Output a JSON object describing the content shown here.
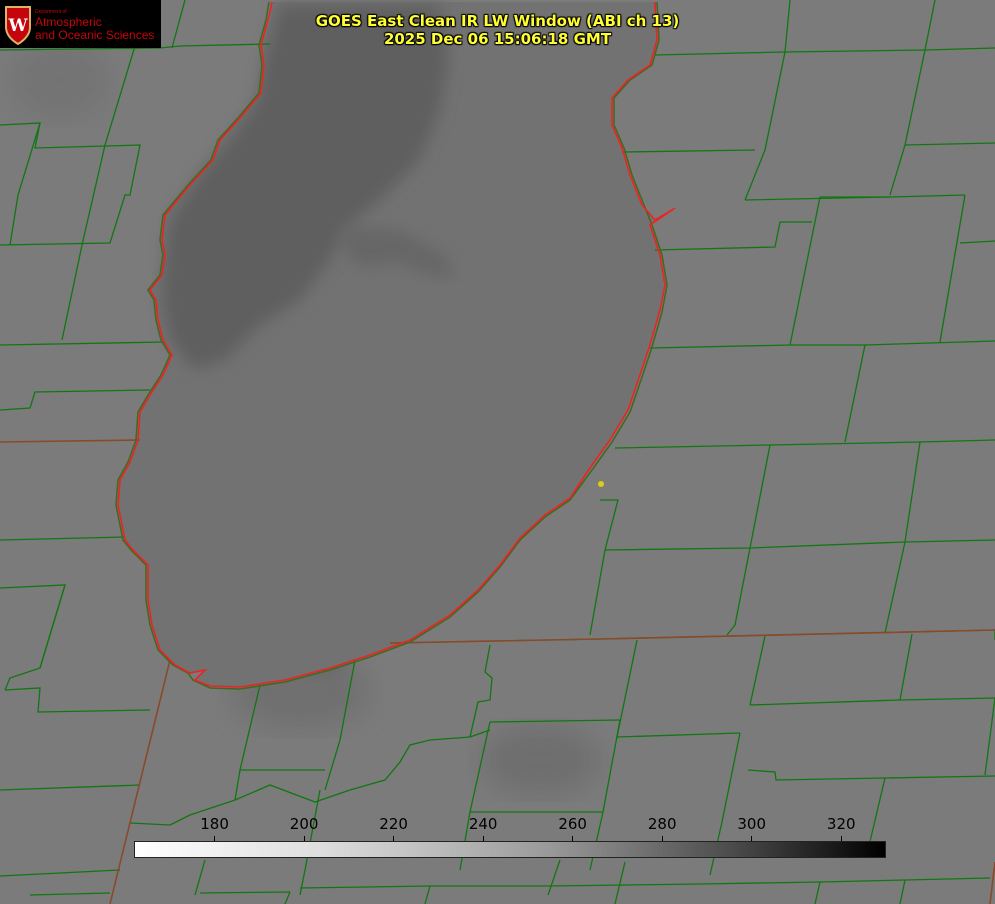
{
  "title": {
    "line1": "GOES East Clean IR LW Window (ABI ch 13)",
    "line2": "2025 Dec 06 15:06:18 GMT"
  },
  "logo": {
    "department": "Department of",
    "line1": "Atmospheric",
    "line2": "and Oceanic Sciences",
    "seal_letter": "W"
  },
  "colorbar": {
    "ticks": [
      "180",
      "200",
      "220",
      "240",
      "260",
      "280",
      "300",
      "320"
    ],
    "range": [
      162,
      330
    ]
  },
  "colors": {
    "land": "#7b7b7b",
    "lake_north": "#5f5f5f",
    "lake_south": "#727272",
    "county_lines": "#117711",
    "shoreline": "#ee2222",
    "title": "#ffff33",
    "marker": "#ddcc11"
  }
}
